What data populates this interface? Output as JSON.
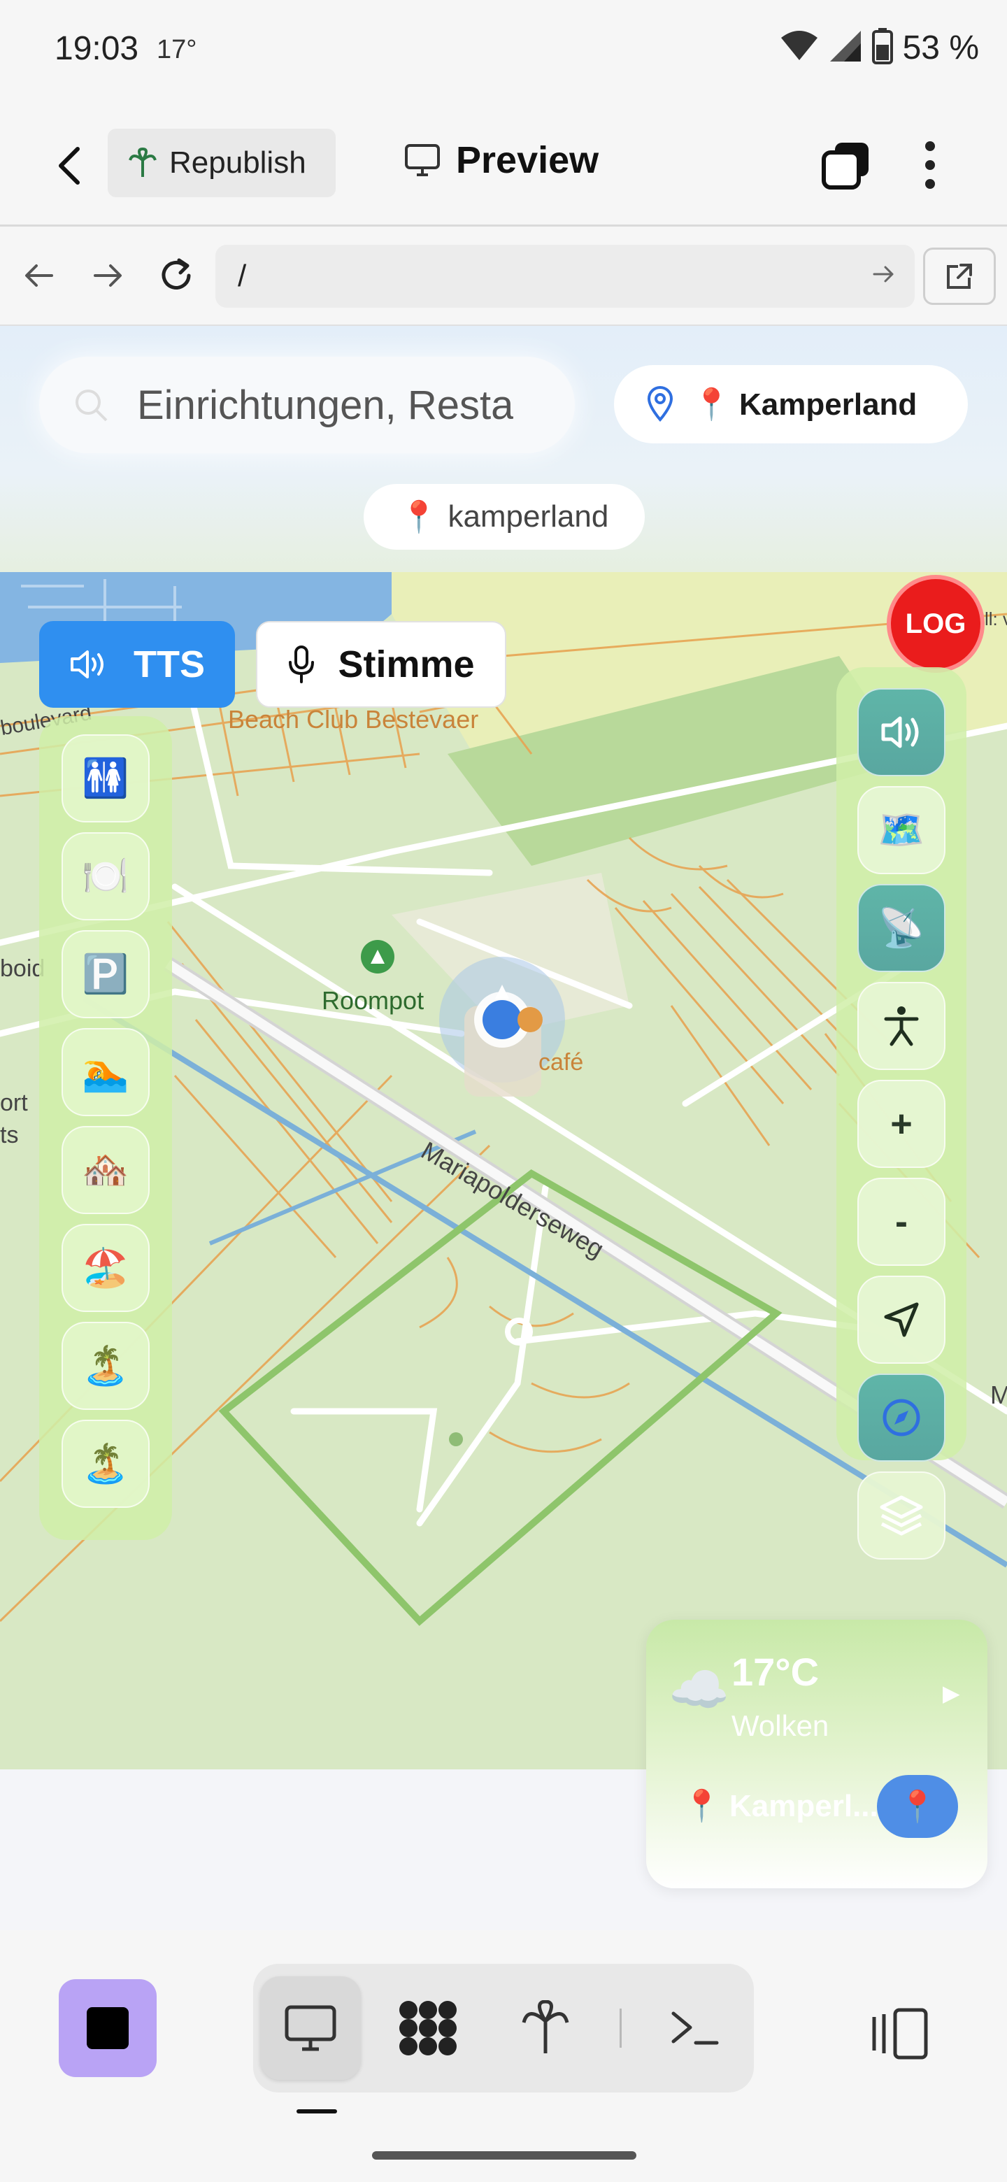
{
  "status_bar": {
    "time": "19:03",
    "temperature": "17°",
    "battery_percent": "53 %"
  },
  "toolbar": {
    "republish_label": "Republish",
    "preview_label": "Preview"
  },
  "browser": {
    "url": "/"
  },
  "header": {
    "search_placeholder": "Einrichtungen, Resta",
    "location_label": "📍 Kamperland",
    "location_chip": "kamperland",
    "location_chip_pin": "📍"
  },
  "map": {
    "tts_label": "TTS",
    "voice_label": "Stimme",
    "log_label": "LOG",
    "labels": {
      "beach_club": "Beach Club Bestevaer",
      "roompot": "Roompot",
      "street": "Mariapolderseweg",
      "cafe": "café",
      "boulevard": "boulevard",
      "edge_boid": "boid",
      "edge_ort": "ort",
      "edge_ts": "ts",
      "edge_m": "M",
      "edge_v": "ll: v"
    },
    "left_panel": [
      "🚻",
      "🍽️",
      "🅿️",
      "🏊",
      "🏘️",
      "🏖️",
      "🏝️",
      "🏝️"
    ],
    "right_panel": {
      "zoom_in": "+",
      "zoom_out": "-",
      "satellite_emoji": "📡",
      "map_emoji": "🗺️"
    }
  },
  "weather": {
    "icon": "☁️",
    "temperature": "17°C",
    "condition": "Wolken",
    "play": "▶",
    "location": "📍 Kamperl...",
    "pin": "📍"
  },
  "colors": {
    "tts_blue": "#2f8ff0",
    "log_red": "#ea1c1c",
    "stop_purple": "#b9a3f5",
    "map_green": "#d8e8c4",
    "road_orange": "#e7a453"
  }
}
